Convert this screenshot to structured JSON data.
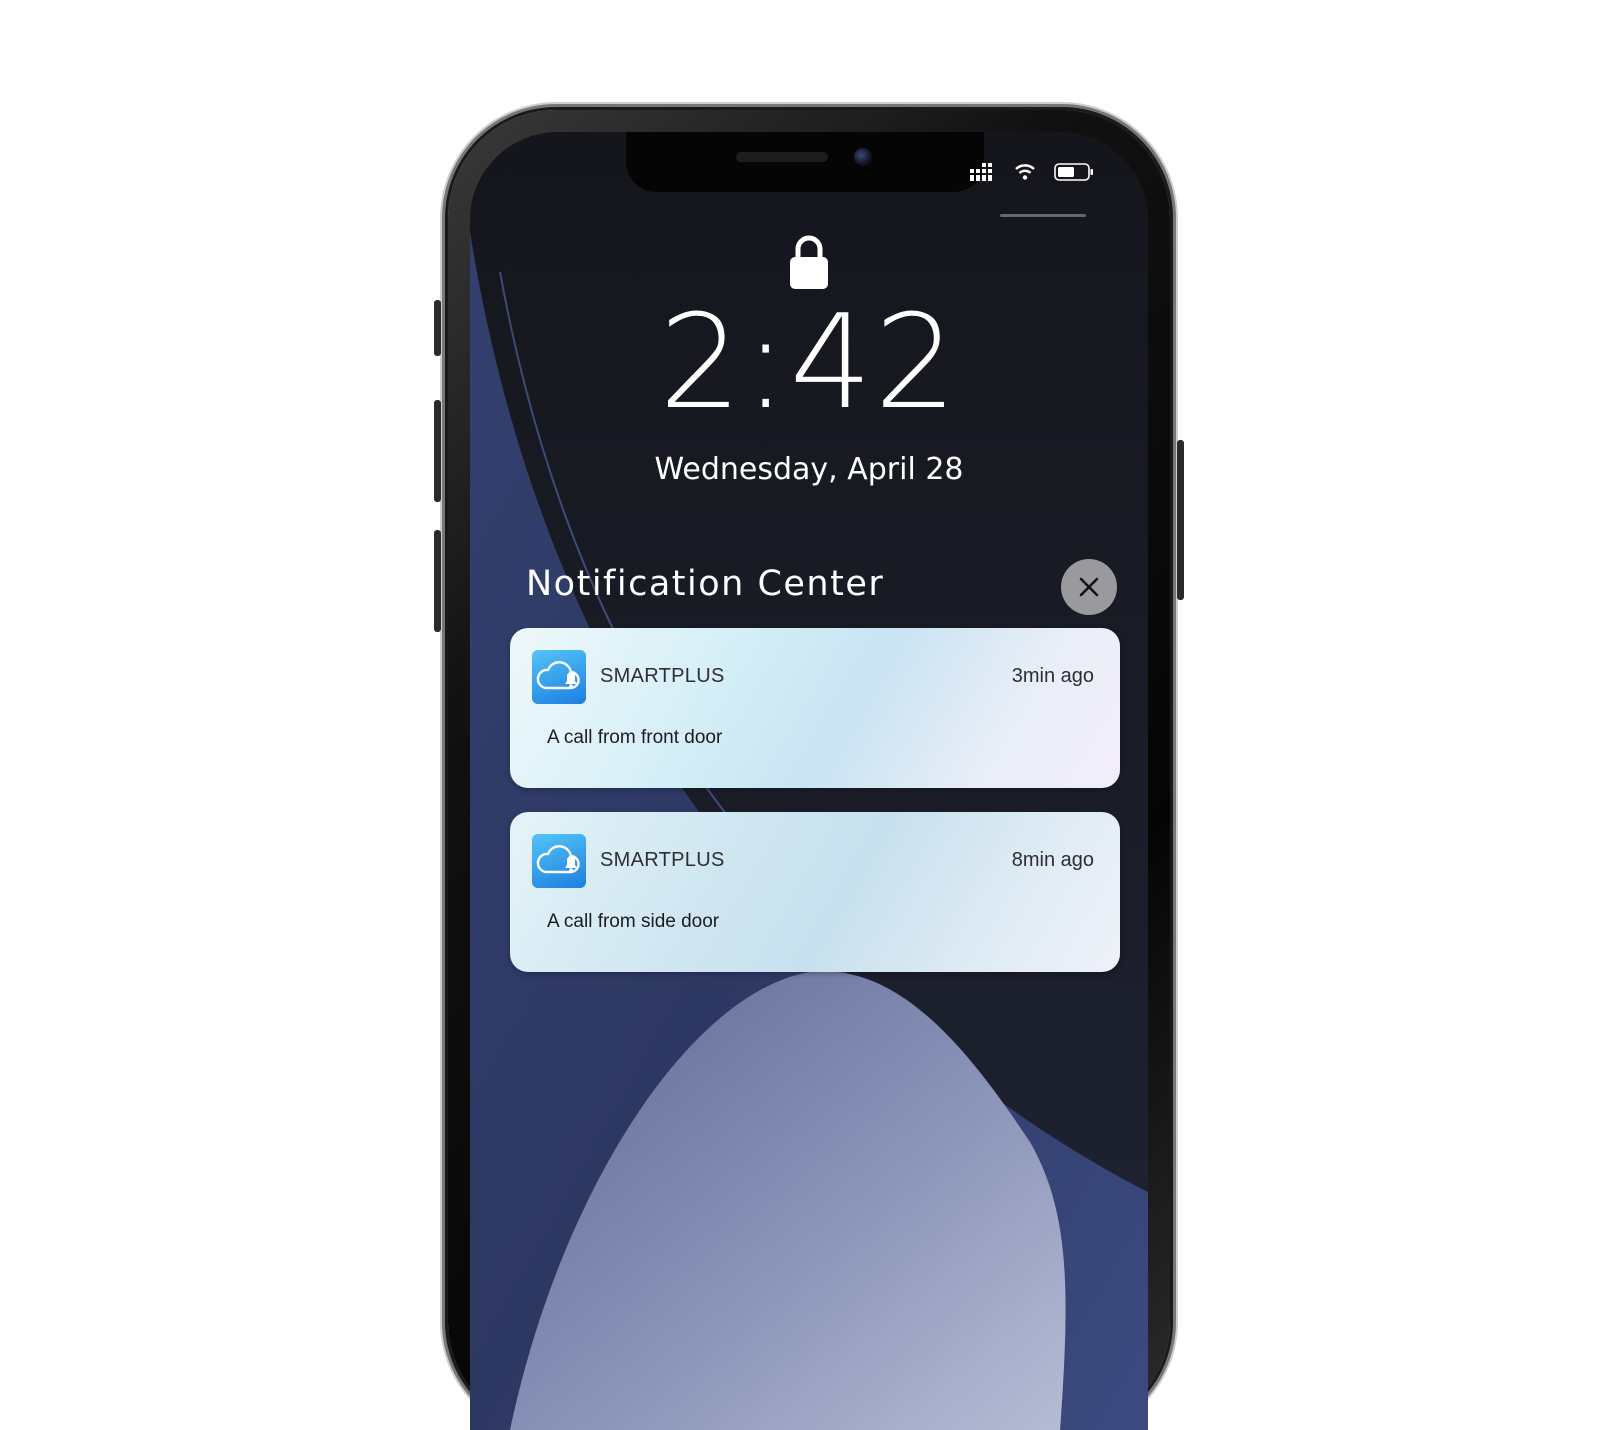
{
  "status_bar": {
    "icons": [
      "cellular-signal-icon",
      "wifi-icon",
      "battery-icon"
    ]
  },
  "lock_screen": {
    "lock_icon": "lock-icon",
    "time": "2:42",
    "date": "Wednesday, April 28"
  },
  "notification_center": {
    "title": "Notification Center",
    "close_icon": "close-icon",
    "notifications": [
      {
        "app": "SMARTPLUS",
        "time": "3min ago",
        "message": "A call from front door",
        "icon": "cloud-bell-icon"
      },
      {
        "app": "SMARTPLUS",
        "time": "8min ago",
        "message": "A call from side door",
        "icon": "cloud-bell-icon"
      }
    ]
  },
  "colors": {
    "app_icon_accent": "#2a8fe8",
    "close_button": "#9a9a9e"
  }
}
